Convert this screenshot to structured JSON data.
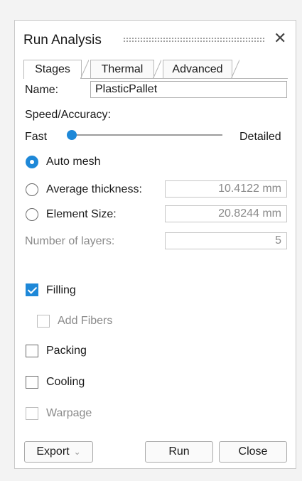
{
  "dialog": {
    "title": "Run Analysis",
    "close_symbol": "✕"
  },
  "tabs": [
    {
      "label": "Stages",
      "active": true
    },
    {
      "label": "Thermal",
      "active": false
    },
    {
      "label": "Advanced",
      "active": false
    }
  ],
  "name_field": {
    "label": "Name:",
    "value": "PlasticPallet"
  },
  "speed_accuracy": {
    "label": "Speed/Accuracy:",
    "min_label": "Fast",
    "max_label": "Detailed",
    "level": 0.0
  },
  "mesh_options": [
    {
      "label": "Auto mesh",
      "selected": true
    },
    {
      "label": "Average thickness:",
      "selected": false,
      "value": "10.4122 mm"
    },
    {
      "label": "Element Size:",
      "selected": false,
      "value": "20.8244 mm"
    }
  ],
  "layers": {
    "label": "Number of layers:",
    "value": "5"
  },
  "stages": [
    {
      "label": "Filling",
      "checked": true,
      "enabled": true
    },
    {
      "label": "Add Fibers",
      "checked": false,
      "enabled": false
    },
    {
      "label": "Packing",
      "checked": false,
      "enabled": true
    },
    {
      "label": "Cooling",
      "checked": false,
      "enabled": true
    },
    {
      "label": "Warpage",
      "checked": false,
      "enabled": false
    }
  ],
  "buttons": {
    "export": "Export",
    "export_caret": "⌄",
    "run": "Run",
    "close": "Close"
  },
  "colors": {
    "accent": "#1e88d8",
    "disabled_text": "#8a8a8a"
  }
}
